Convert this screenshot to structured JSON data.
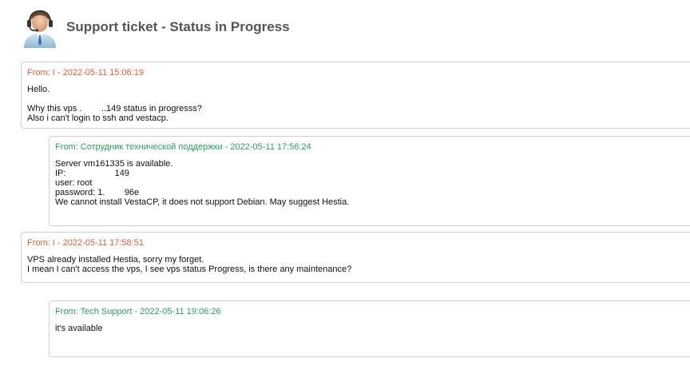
{
  "header": {
    "title": "Support ticket - Status in Progress",
    "icon": "support-agent-icon"
  },
  "messages": [
    {
      "role": "client",
      "meta": "From: I        - 2022-05-11 15:06:19",
      "lines": [
        "Hello.",
        "",
        "Why this vps .        ..149 status in progresss?",
        "Also i can't login to ssh and vestacp."
      ]
    },
    {
      "role": "staff",
      "meta": "From: Сотрудник технической поддержки - 2022-05-11 17:56:24",
      "lines": [
        "Server vm161335 is available.",
        "IP:                    149",
        "user: root",
        "password: 1.        96e",
        "We cannot install VestaCP, it does not support Debian. May suggest Hestia."
      ]
    },
    {
      "role": "client",
      "meta": "From: I        - 2022-05-11 17:58:51",
      "lines": [
        "VPS already installed Hestia, sorry my forget.",
        "I mean I can't access the vps, I see vps status Progress, is there any maintenance?"
      ]
    },
    {
      "role": "staff",
      "meta": "From: Tech Support - 2022-05-11 19:06:26",
      "lines": [
        "it's available"
      ]
    }
  ],
  "colors": {
    "client_meta": "#e0623a",
    "staff_meta": "#2e9e5e",
    "title": "#555555",
    "border": "#cfcfcf"
  }
}
